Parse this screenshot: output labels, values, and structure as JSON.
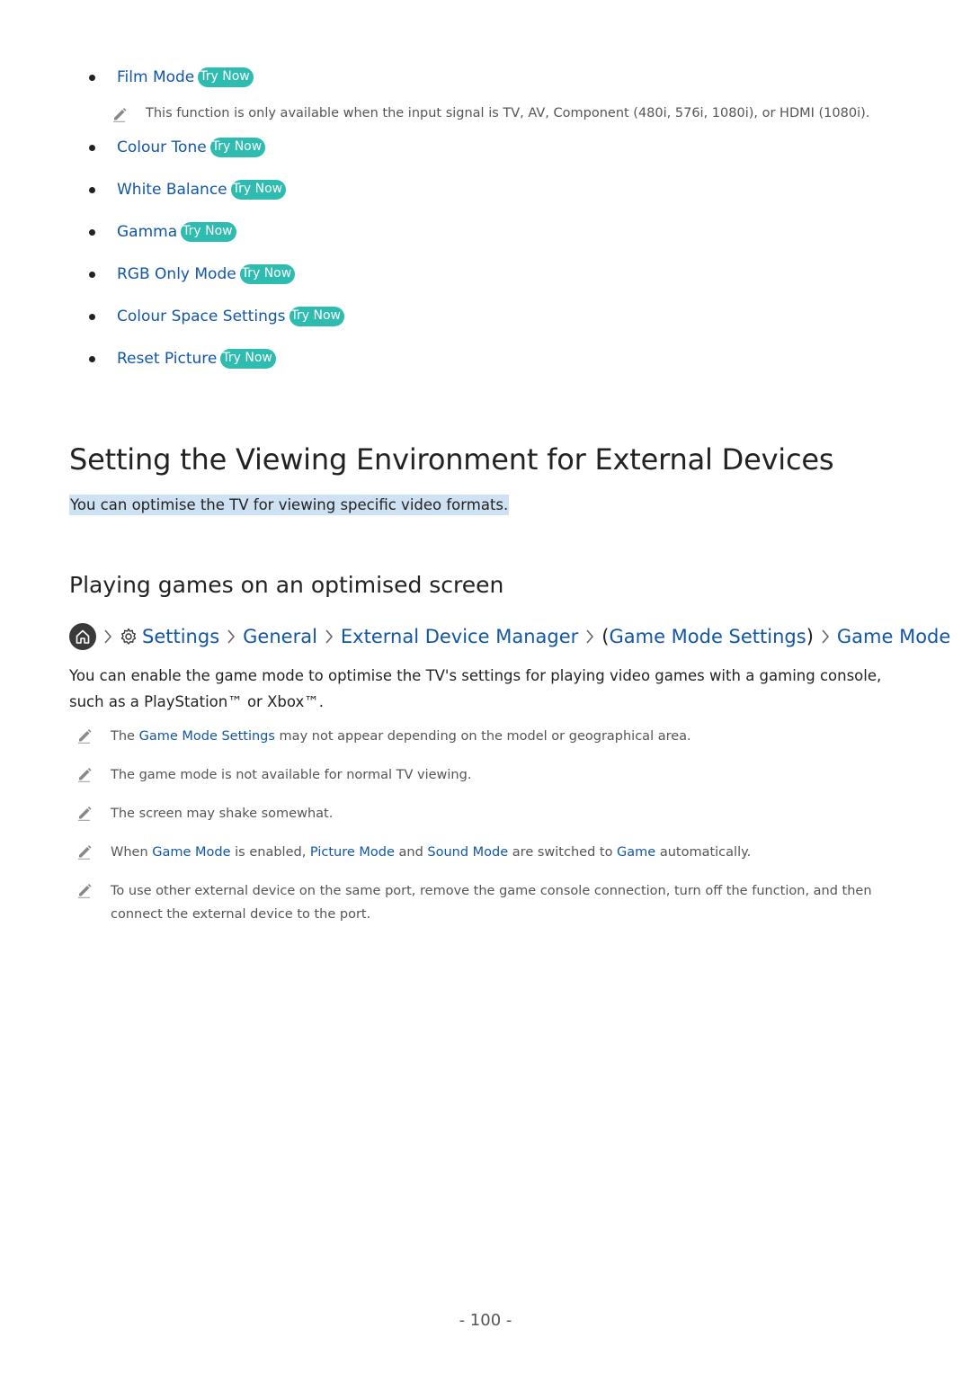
{
  "top_list": {
    "items": [
      {
        "label": "Film Mode",
        "badge": "Try Now"
      },
      {
        "label": "Colour Tone",
        "badge": "Try Now"
      },
      {
        "label": "White Balance",
        "badge": "Try Now"
      },
      {
        "label": "Gamma",
        "badge": "Try Now"
      },
      {
        "label": "RGB Only Mode",
        "badge": "Try Now"
      },
      {
        "label": "Colour Space Settings",
        "badge": "Try Now"
      },
      {
        "label": "Reset Picture",
        "badge": "Try Now"
      }
    ],
    "film_mode_note": "This function is only available when the input signal is TV, AV, Component (480i, 576i, 1080i), or HDMI (1080i)."
  },
  "section": {
    "title": "Setting the Viewing Environment for External Devices",
    "intro": "You can optimise the TV for viewing specific video formats."
  },
  "subsection": {
    "title": "Playing games on an optimised screen",
    "breadcrumb": {
      "home_icon": "home-icon",
      "settings_icon": "gear-icon",
      "items": [
        "Settings",
        "General",
        "External Device Manager",
        "(Game Mode Settings)",
        "Game Mode"
      ],
      "paren_open": "(",
      "paren_inner": "Game Mode Settings",
      "paren_close": ")"
    },
    "body": "You can enable the game mode to optimise the TV's settings for playing video games with a gaming console, such as a PlayStation™ or Xbox™.",
    "notes": [
      {
        "parts": [
          {
            "t": "The "
          },
          {
            "t": "Game Mode Settings",
            "link": true
          },
          {
            "t": " may not appear depending on the model or geographical area."
          }
        ]
      },
      {
        "parts": [
          {
            "t": "The game mode is not available for normal TV viewing."
          }
        ]
      },
      {
        "parts": [
          {
            "t": "The screen may shake somewhat."
          }
        ]
      },
      {
        "parts": [
          {
            "t": "When "
          },
          {
            "t": "Game Mode",
            "link": true
          },
          {
            "t": " is enabled, "
          },
          {
            "t": "Picture Mode",
            "link": true
          },
          {
            "t": " and "
          },
          {
            "t": "Sound Mode",
            "link": true
          },
          {
            "t": " are switched to "
          },
          {
            "t": "Game",
            "link": true
          },
          {
            "t": " automatically."
          }
        ]
      },
      {
        "parts": [
          {
            "t": "To use other external device on the same port, remove the game console connection, turn off the function, and then connect the external device to the port."
          }
        ]
      }
    ]
  },
  "footer": {
    "page_number": "- 100 -"
  },
  "colors": {
    "link": "#1257a5",
    "badge": "#2ebcb0",
    "highlight": "#cfe2f4"
  }
}
